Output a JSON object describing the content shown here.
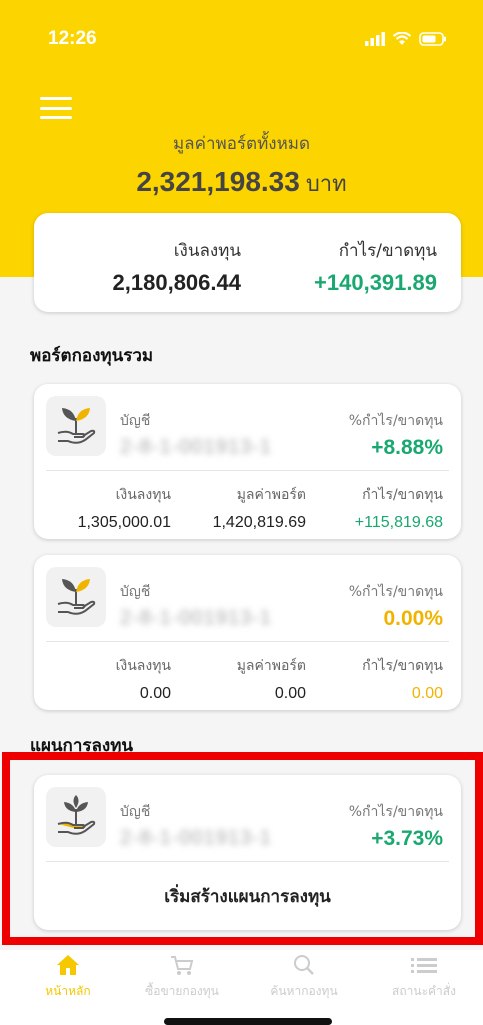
{
  "status_bar": {
    "time": "12:26"
  },
  "header": {
    "total_label": "มูลค่าพอร์ตทั้งหมด",
    "total_value": "2,321,198.33",
    "total_unit": "บาท"
  },
  "summary": {
    "invest_label": "เงินลงทุน",
    "invest_value": "2,180,806.44",
    "profit_label": "กำไร/ขาดทุน",
    "profit_value": "+140,391.89"
  },
  "sections": {
    "portfolio_title": "พอร์ตกองทุนรวม",
    "plan_title": "แผนการลงทุน"
  },
  "funds": [
    {
      "account_label": "บัญชี",
      "account_number": "2-8-1-001913-1",
      "pct_label": "%กำไร/ขาดทุน",
      "pct_value": "+8.88%",
      "invest_label": "เงินลงทุน",
      "invest_value": "1,305,000.01",
      "market_label": "มูลค่าพอร์ต",
      "market_value": "1,420,819.69",
      "profit_label": "กำไร/ขาดทุน",
      "profit_value": "+115,819.68"
    },
    {
      "account_label": "บัญชี",
      "account_number": "2-8-1-001913-1",
      "pct_label": "%กำไร/ขาดทุน",
      "pct_value": "0.00%",
      "invest_label": "เงินลงทุน",
      "invest_value": "0.00",
      "market_label": "มูลค่าพอร์ต",
      "market_value": "0.00",
      "profit_label": "กำไร/ขาดทุน",
      "profit_value": "0.00"
    }
  ],
  "plan": {
    "account_label": "บัญชี",
    "account_number": "2-8-1-001913-1",
    "pct_label": "%กำไร/ขาดทุน",
    "pct_value": "+3.73%",
    "create_label": "เริ่มสร้างแผนการลงทุน"
  },
  "nav": [
    {
      "label": "หน้าหลัก",
      "icon": "home-icon",
      "active": true
    },
    {
      "label": "ซื้อขายกองทุน",
      "icon": "cart-icon",
      "active": false
    },
    {
      "label": "ค้นหากองทุน",
      "icon": "search-icon",
      "active": false
    },
    {
      "label": "สถานะคำสั่ง",
      "icon": "list-icon",
      "active": false
    }
  ],
  "colors": {
    "brand_yellow": "#fcd400",
    "gain_green": "#1aa870",
    "neutral_gold": "#f0b400",
    "highlight_red": "#ee0000"
  }
}
